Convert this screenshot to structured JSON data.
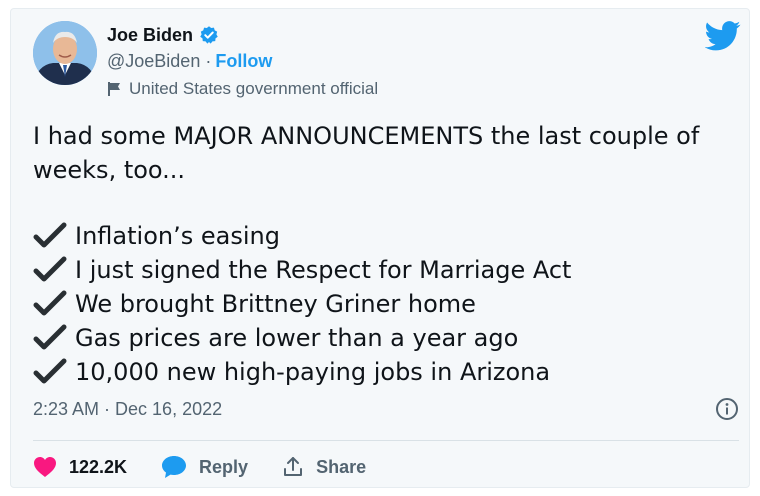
{
  "author": {
    "name": "Joe Biden",
    "handle": "@JoeBiden",
    "separator": "·",
    "follow_label": "Follow",
    "account_label": "United States government official"
  },
  "tweet": {
    "text_line1": "I had some MAJOR ANNOUNCEMENTS the last couple of",
    "text_line2": "weeks, too...",
    "list": [
      {
        "text": "Inflation’s easing"
      },
      {
        "text": "I just signed the Respect for Marriage Act"
      },
      {
        "text": "We brought Brittney Griner home"
      },
      {
        "text": "Gas prices are lower than a year ago"
      },
      {
        "text": "10,000 new high-paying jobs in Arizona"
      }
    ],
    "timestamp": "2:23 AM · Dec 16, 2022"
  },
  "actions": {
    "likes_count": "122.2K",
    "reply_label": "Reply",
    "share_label": "Share"
  },
  "icons": {
    "verified": "verified-badge-icon",
    "flag": "flag-icon",
    "logo": "twitter-bird-icon",
    "info": "info-icon",
    "heart": "heart-icon",
    "reply": "reply-bubble-icon",
    "share": "share-icon",
    "check": "check-mark-icon"
  },
  "colors": {
    "accent": "#1d9bf0",
    "like": "#f91880",
    "text": "#0f1419",
    "muted": "#536471",
    "card_bg": "#f5f8fa"
  }
}
